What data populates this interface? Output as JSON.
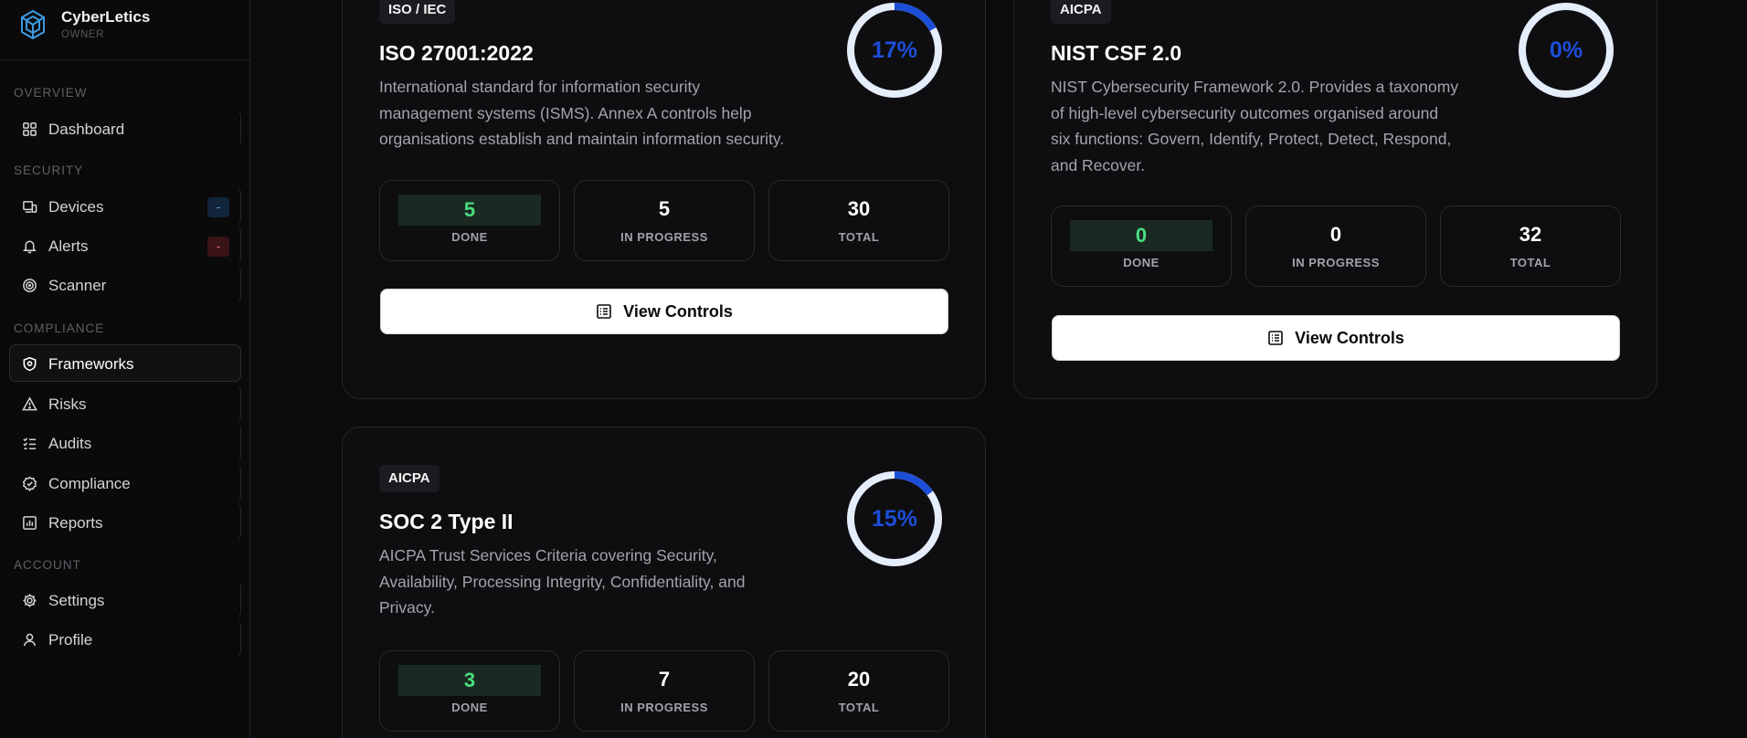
{
  "brand": {
    "name": "CyberLetics",
    "role": "OWNER"
  },
  "sidebar": {
    "sections": {
      "overview": "OVERVIEW",
      "security": "SECURITY",
      "compliance": "COMPLIANCE",
      "account": "ACCOUNT"
    },
    "items": {
      "dashboard": {
        "label": "Dashboard",
        "icon": "grid-icon"
      },
      "devices": {
        "label": "Devices",
        "icon": "devices-icon",
        "badge": "-"
      },
      "alerts": {
        "label": "Alerts",
        "icon": "bell-icon",
        "badge": "-"
      },
      "scanner": {
        "label": "Scanner",
        "icon": "radar-icon"
      },
      "frameworks": {
        "label": "Frameworks",
        "icon": "shield-icon",
        "active": true
      },
      "risks": {
        "label": "Risks",
        "icon": "warning-icon"
      },
      "audits": {
        "label": "Audits",
        "icon": "checklist-icon"
      },
      "compliance": {
        "label": "Compliance",
        "icon": "badge-check-icon"
      },
      "reports": {
        "label": "Reports",
        "icon": "chart-icon"
      },
      "settings": {
        "label": "Settings",
        "icon": "gear-icon"
      },
      "profile": {
        "label": "Profile",
        "icon": "user-icon"
      }
    }
  },
  "frameworks": [
    {
      "tag": "ISO / IEC",
      "title": "ISO 27001:2022",
      "description_lines": [
        "International standard for information security",
        "management systems (ISMS). Annex A controls help",
        "organisations establish and maintain information security."
      ],
      "progress_percent": 17,
      "progress_label": "17%",
      "done": "5",
      "done_label": "DONE",
      "in_progress": "5",
      "in_progress_label": "IN PROGRESS",
      "total": "30",
      "total_label": "TOTAL",
      "button_label": "View Controls"
    },
    {
      "tag": "AICPA",
      "title": "NIST CSF 2.0",
      "description_lines": [
        "NIST Cybersecurity Framework 2.0. Provides a taxonomy",
        "of high-level cybersecurity outcomes organised around",
        "six functions: Govern, Identify, Protect, Detect, Respond,",
        "and Recover."
      ],
      "progress_percent": 0,
      "progress_label": "0%",
      "done": "0",
      "done_label": "DONE",
      "in_progress": "0",
      "in_progress_label": "IN PROGRESS",
      "total": "32",
      "total_label": "TOTAL",
      "button_label": "View Controls"
    },
    {
      "tag": "AICPA",
      "title": "SOC 2 Type II",
      "description_lines": [
        "AICPA Trust Services Criteria covering Security,",
        "Availability, Processing Integrity, Confidentiality, and",
        "Privacy."
      ],
      "progress_percent": 15,
      "progress_label": "15%",
      "done": "3",
      "done_label": "DONE",
      "in_progress": "7",
      "in_progress_label": "IN PROGRESS",
      "total": "20",
      "total_label": "TOTAL"
    }
  ],
  "colors": {
    "accent": "#1d4ed8",
    "ring_track": "#e5edfb",
    "done_text": "#4ade80",
    "done_bg": "#1a2a22"
  }
}
